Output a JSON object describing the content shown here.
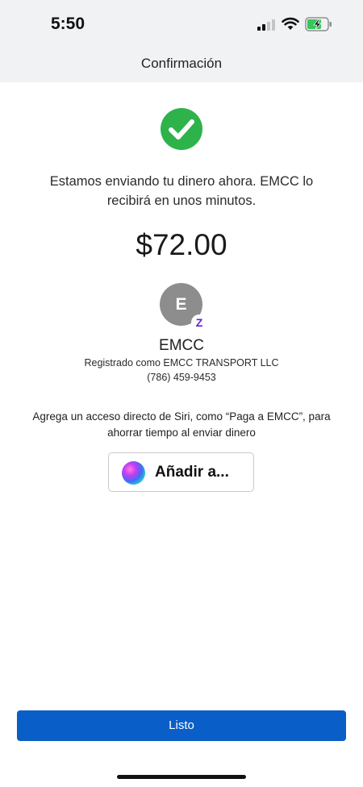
{
  "status_bar": {
    "time": "5:50",
    "battery_state": "charging",
    "battery_color": "#34c759"
  },
  "header": {
    "title": "Confirmación"
  },
  "confirmation": {
    "icon": "check-circle-icon",
    "icon_color": "#2db34a",
    "message": "Estamos enviando tu dinero ahora. EMCC lo recibirá en unos minutos.",
    "amount": "$72.00"
  },
  "recipient": {
    "initial": "E",
    "badge_glyph": "Z",
    "badge_color": "#6b1fd1",
    "name": "EMCC",
    "registered_as": "Registrado como EMCC TRANSPORT LLC",
    "phone": "(786) 459-9453"
  },
  "siri": {
    "prompt": "Agrega un acceso directo de Siri, como “Paga a EMCC”, para ahorrar tiempo al enviar dinero",
    "button_label": "Añadir a..."
  },
  "footer": {
    "done_label": "Listo",
    "button_color": "#0a5ec7"
  }
}
